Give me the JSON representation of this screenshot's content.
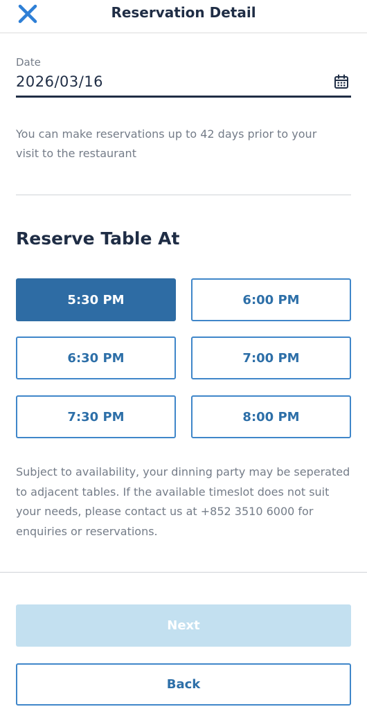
{
  "header": {
    "title": "Reservation Detail",
    "close_icon": "close-icon"
  },
  "date": {
    "label": "Date",
    "value": "2026/03/16",
    "icon": "calendar-icon"
  },
  "note": "You can make reservations up to 42 days prior to your visit to the restaurant",
  "section_title": "Reserve Table At",
  "slots": [
    {
      "label": "5:30 PM",
      "selected": true
    },
    {
      "label": "6:00 PM",
      "selected": false
    },
    {
      "label": "6:30 PM",
      "selected": false
    },
    {
      "label": "7:00 PM",
      "selected": false
    },
    {
      "label": "7:30 PM",
      "selected": false
    },
    {
      "label": "8:00 PM",
      "selected": false
    }
  ],
  "disclaimer": "Subject to availability, your dinning party may be seperated to adjacent tables. If the available timeslot does not suit your needs, please contact us at +852 3510 6000 for enquiries or reservations.",
  "buttons": {
    "next": "Next",
    "back": "Back"
  },
  "colors": {
    "accent": "#2e6ca4",
    "border_accent": "#3f86c9",
    "disabled_button": "#c3e0f0",
    "text_dark": "#1f2d45",
    "text_muted": "#747c88"
  }
}
